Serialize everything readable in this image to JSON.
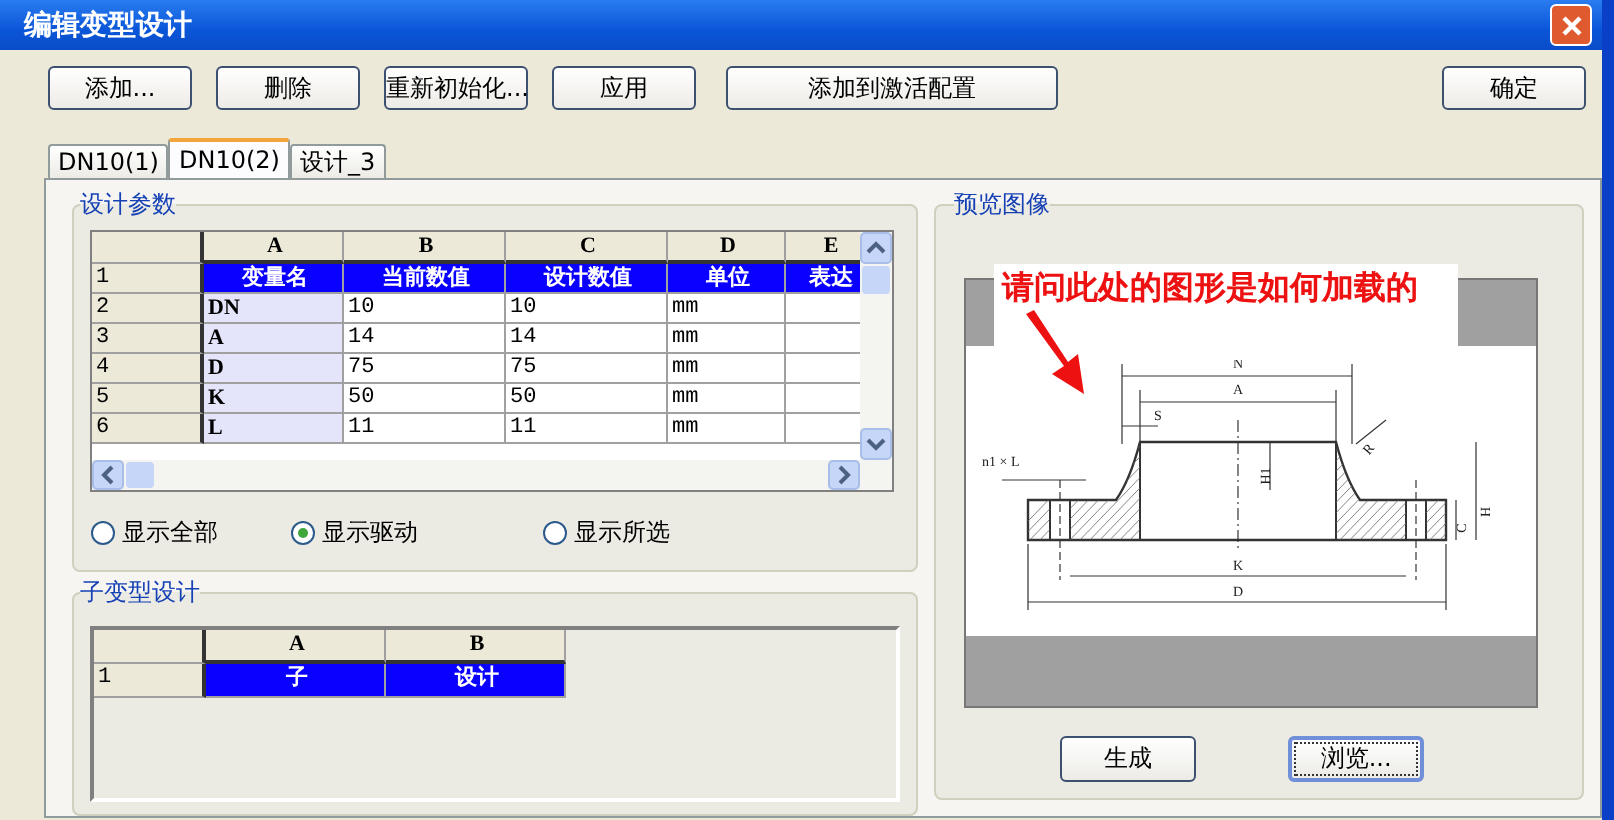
{
  "window": {
    "title": "编辑变型设计"
  },
  "toolbar": [
    {
      "label": "添加..."
    },
    {
      "label": "删除"
    },
    {
      "label": "重新初始化..."
    },
    {
      "label": "应用"
    },
    {
      "label": "添加到激活配置",
      "kind": "wide"
    }
  ],
  "ok_button": "确定",
  "tabs": [
    {
      "label": "DN10(1)",
      "selected": false
    },
    {
      "label": "DN10(2)",
      "selected": true
    },
    {
      "label": "设计_3",
      "selected": false
    }
  ],
  "params": {
    "title": "设计参数",
    "columns": [
      "A",
      "B",
      "C",
      "D",
      "E"
    ],
    "rows": [
      {
        "header": "1",
        "kind": "header",
        "cells": [
          "变量名",
          "当前数值",
          "设计数值",
          "单位",
          "表达"
        ]
      },
      {
        "header": "2",
        "kind": "data",
        "cells": [
          "DN",
          "10",
          "10",
          "mm",
          ""
        ]
      },
      {
        "header": "3",
        "kind": "data",
        "cells": [
          "A",
          "14",
          "14",
          "mm",
          ""
        ]
      },
      {
        "header": "4",
        "kind": "data",
        "cells": [
          "D",
          "75",
          "75",
          "mm",
          ""
        ]
      },
      {
        "header": "5",
        "kind": "data",
        "cells": [
          "K",
          "50",
          "50",
          "mm",
          ""
        ]
      },
      {
        "header": "6",
        "kind": "data",
        "cells": [
          "L",
          "11",
          "11",
          "mm",
          ""
        ]
      }
    ]
  },
  "filters": [
    {
      "label": "显示全部",
      "selected": false
    },
    {
      "label": "显示驱动",
      "selected": true
    },
    {
      "label": "显示所选",
      "selected": false
    }
  ],
  "sub_design": {
    "title": "子变型设计",
    "columns": [
      "A",
      "B"
    ],
    "rows": [
      {
        "header": "1",
        "kind": "header",
        "cells": [
          "子",
          "设计"
        ]
      }
    ]
  },
  "preview": {
    "title": "预览图像",
    "annotation": "请问此处的图形是如何加载的",
    "dimension_labels": [
      "N",
      "A",
      "S",
      "H1",
      "R",
      "n1 × L",
      "H",
      "C",
      "K",
      "D"
    ],
    "buttons": [
      {
        "label": "生成",
        "focused": false
      },
      {
        "label": "浏览...",
        "focused": true
      }
    ]
  }
}
